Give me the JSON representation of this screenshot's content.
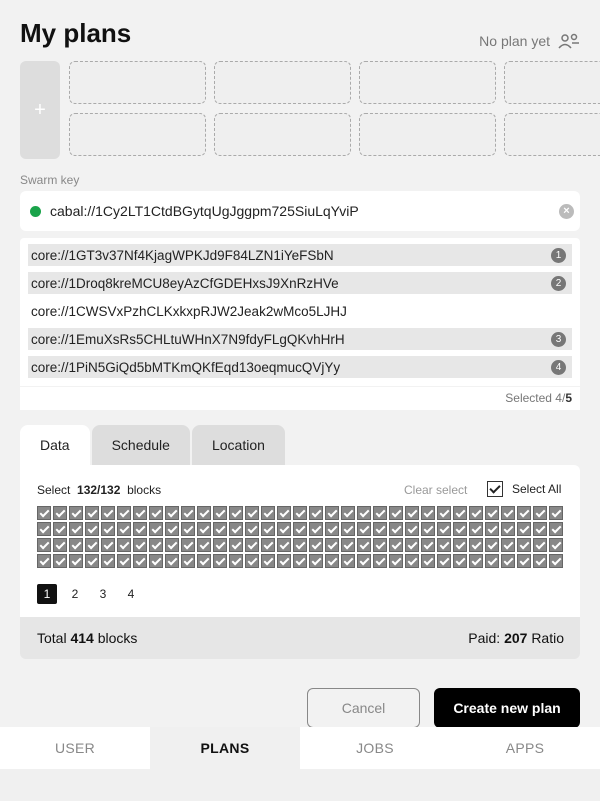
{
  "header": {
    "title": "My plans",
    "no_plan_text": "No plan yet",
    "no_plan_icon": "users-off-icon"
  },
  "slots": {
    "add_label": "+"
  },
  "swarm": {
    "label": "Swarm key",
    "value": "cabal://1Cy2LT1CtdBGytqUgJggpm725SiuLqYviP",
    "status_color": "#1aa34a"
  },
  "cores": [
    {
      "url": "core://1GT3v37Nf4KjagWPKJd9F84LZN1iYeFSbN",
      "badge": "1",
      "selected": true
    },
    {
      "url": "core://1Droq8kreMCU8eyAzCfGDEHxsJ9XnRzHVe",
      "badge": "2",
      "selected": true
    },
    {
      "url": "core://1CWSVxPzhCLKxkxpRJW2Jeak2wMco5LJHJ",
      "badge": "",
      "selected": false
    },
    {
      "url": "core://1EmuXsRs5CHLtuWHnX7N9fdyFLgQKvhHrH",
      "badge": "3",
      "selected": true
    },
    {
      "url": "core://1PiN5GiQd5bMTKmQKfEqd13oeqmucQVjYy",
      "badge": "4",
      "selected": true
    }
  ],
  "selected": {
    "label": "Selected 4/",
    "max": "5"
  },
  "tabs": [
    "Data",
    "Schedule",
    "Location"
  ],
  "data_panel": {
    "select_word": "Select",
    "select_count": "132/132",
    "blocks_word": "blocks",
    "clear_select": "Clear select",
    "select_all": "Select All",
    "pages": [
      "1",
      "2",
      "3",
      "4"
    ],
    "current_page": "1"
  },
  "totals": {
    "total_word": "Total",
    "total_value": "414",
    "blocks_word": "blocks",
    "paid_word": "Paid:",
    "paid_value": "207",
    "ratio_word": "Ratio"
  },
  "actions": {
    "cancel": "Cancel",
    "create": "Create new plan"
  },
  "nav": [
    "USER",
    "PLANS",
    "JOBS",
    "APPS"
  ],
  "nav_active": "PLANS"
}
